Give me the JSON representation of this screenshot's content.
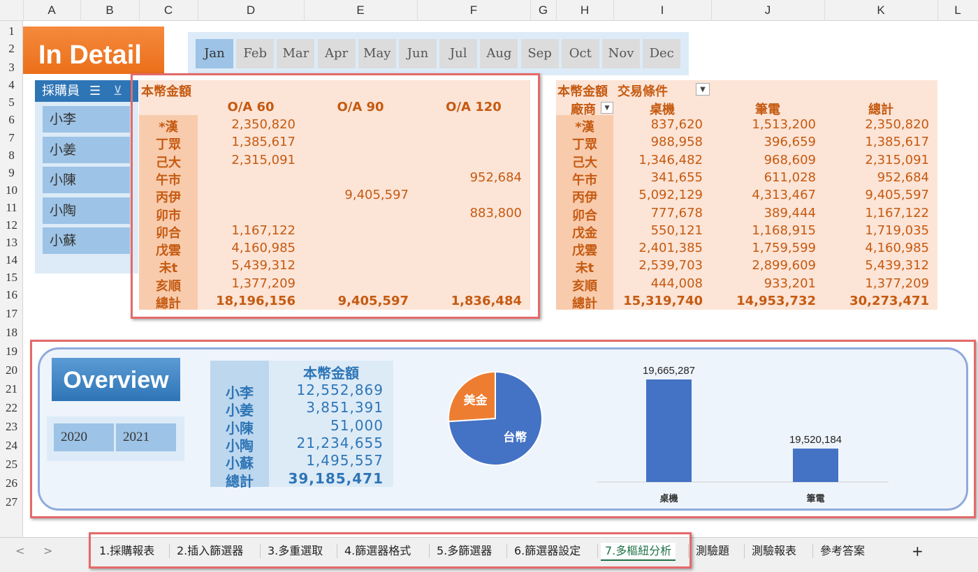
{
  "columns": [
    "A",
    "B",
    "C",
    "D",
    "E",
    "F",
    "G",
    "H",
    "I",
    "J",
    "K",
    "L"
  ],
  "rows": [
    "1",
    "2",
    "3",
    "4",
    "5",
    "6",
    "7",
    "8",
    "9",
    "10",
    "11",
    "12",
    "13",
    "14",
    "15",
    "16",
    "17",
    "18",
    "19",
    "20",
    "21",
    "22",
    "23",
    "24",
    "25",
    "26",
    "27"
  ],
  "detail_title": "In Detail",
  "months": [
    "Jan",
    "Feb",
    "Mar",
    "Apr",
    "May",
    "Jun",
    "Jul",
    "Aug",
    "Sep",
    "Oct",
    "Nov",
    "Dec"
  ],
  "selected_month": "Jan",
  "buyer_slicer": {
    "title": "採購員",
    "items": [
      "小李",
      "小姜",
      "小陳",
      "小陶",
      "小蘇"
    ]
  },
  "pivot1": {
    "corner": "本幣金額",
    "headers": [
      "O/A 60",
      "O/A 90",
      "O/A 120"
    ],
    "rows": [
      {
        "label": "*漢",
        "v": [
          "2,350,820",
          "",
          ""
        ]
      },
      {
        "label": "丁眾",
        "v": [
          "1,385,617",
          "",
          ""
        ]
      },
      {
        "label": "己大",
        "v": [
          "2,315,091",
          "",
          ""
        ]
      },
      {
        "label": "午市",
        "v": [
          "",
          "",
          "952,684"
        ]
      },
      {
        "label": "丙伊",
        "v": [
          "",
          "9,405,597",
          ""
        ]
      },
      {
        "label": "卯市",
        "v": [
          "",
          "",
          "883,800"
        ]
      },
      {
        "label": "卯合",
        "v": [
          "1,167,122",
          "",
          ""
        ]
      },
      {
        "label": "戊雲",
        "v": [
          "4,160,985",
          "",
          ""
        ]
      },
      {
        "label": "未t",
        "v": [
          "5,439,312",
          "",
          ""
        ]
      },
      {
        "label": "亥順",
        "v": [
          "1,377,209",
          "",
          ""
        ]
      }
    ],
    "total": {
      "label": "總計",
      "v": [
        "18,196,156",
        "9,405,597",
        "1,836,484"
      ]
    }
  },
  "pivot2": {
    "corner": "本幣金額",
    "filter_label": "交易條件",
    "row_label": "廠商",
    "headers": [
      "桌機",
      "筆電",
      "總計"
    ],
    "rows": [
      {
        "label": "*漢",
        "v": [
          "837,620",
          "1,513,200",
          "2,350,820"
        ]
      },
      {
        "label": "丁眾",
        "v": [
          "988,958",
          "396,659",
          "1,385,617"
        ]
      },
      {
        "label": "己大",
        "v": [
          "1,346,482",
          "968,609",
          "2,315,091"
        ]
      },
      {
        "label": "午市",
        "v": [
          "341,655",
          "611,028",
          "952,684"
        ]
      },
      {
        "label": "丙伊",
        "v": [
          "5,092,129",
          "4,313,467",
          "9,405,597"
        ]
      },
      {
        "label": "卯合",
        "v": [
          "777,678",
          "389,444",
          "1,167,122"
        ]
      },
      {
        "label": "戊金",
        "v": [
          "550,121",
          "1,168,915",
          "1,719,035"
        ]
      },
      {
        "label": "戊雲",
        "v": [
          "2,401,385",
          "1,759,599",
          "4,160,985"
        ]
      },
      {
        "label": "未t",
        "v": [
          "2,539,703",
          "2,899,609",
          "5,439,312"
        ]
      },
      {
        "label": "亥順",
        "v": [
          "444,008",
          "933,201",
          "1,377,209"
        ]
      }
    ],
    "total": {
      "label": "總計",
      "v": [
        "15,319,740",
        "14,953,732",
        "30,273,471"
      ]
    }
  },
  "overview_title": "Overview",
  "years": [
    "2020",
    "2021"
  ],
  "overview_table": {
    "header": "本幣金額",
    "rows": [
      {
        "label": "小李",
        "v": "12,552,869"
      },
      {
        "label": "小姜",
        "v": "3,851,391"
      },
      {
        "label": "小陳",
        "v": "51,000"
      },
      {
        "label": "小陶",
        "v": "21,234,655"
      },
      {
        "label": "小蘇",
        "v": "1,495,557"
      }
    ],
    "total": {
      "label": "總計",
      "v": "39,185,471"
    }
  },
  "chart_data": [
    {
      "type": "pie",
      "labels": [
        "美金",
        "台幣"
      ],
      "values": [
        0.26,
        0.74
      ],
      "colors": [
        "#ed7d31",
        "#4472c4"
      ]
    },
    {
      "type": "bar",
      "categories": [
        "桌機",
        "筆電"
      ],
      "values": [
        19665287,
        19520184
      ],
      "value_labels": [
        "19,665,287",
        "19,520,184"
      ],
      "color": "#4472c4"
    }
  ],
  "tabs": [
    "1.採購報表",
    "2.插入篩選器",
    "3.多重選取",
    "4.篩選器格式",
    "5.多篩選器",
    "6.篩選器設定",
    "7.多樞紐分析",
    "測驗題",
    "測驗報表",
    "參考答案"
  ],
  "active_tab": "7.多樞紐分析",
  "tab_nav": {
    "prev": "<",
    "next": ">",
    "add": "+"
  }
}
